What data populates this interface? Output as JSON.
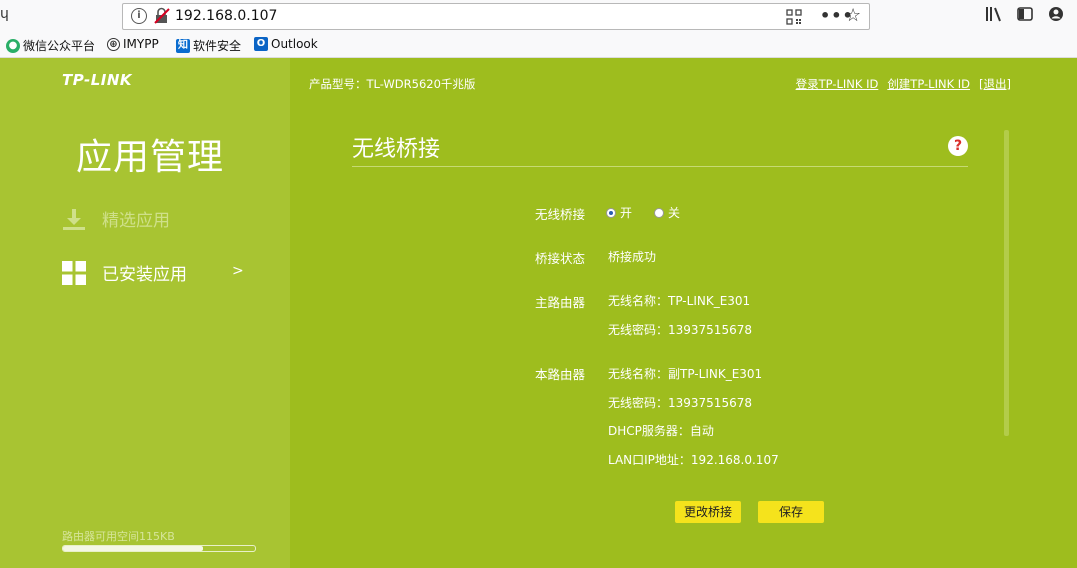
{
  "browser": {
    "url": "192.168.0.107",
    "bookmarks": [
      "微信公众平台",
      "IMYPP",
      "软件安全",
      "Outlook"
    ]
  },
  "sidebar": {
    "logo": "TP-LINK",
    "title": "应用管理",
    "items": [
      {
        "label": "精选应用"
      },
      {
        "label": "已安装应用"
      }
    ],
    "chevron": ">",
    "storage_label": "路由器可用空间115KB",
    "storage_used_fraction": 0.73
  },
  "header": {
    "model": "产品型号：TL-WDR5620千兆版",
    "login_link": "登录TP-LINK ID",
    "create_link": "创建TP-LINK ID",
    "logout_link": "[退出]"
  },
  "main": {
    "title": "无线桥接",
    "help": "?",
    "bridge_label": "无线桥接",
    "radio_on": "开",
    "radio_off": "关",
    "status_label": "桥接状态",
    "status_value": "桥接成功",
    "main_router_label": "主路由器",
    "main_ssid": "无线名称：TP-LINK_E301",
    "main_pwd": "无线密码：13937515678",
    "this_router_label": "本路由器",
    "this_ssid": "无线名称：副TP-LINK_E301",
    "this_pwd": "无线密码：13937515678",
    "dhcp": "DHCP服务器：自动",
    "lan_ip": "LAN口IP地址：192.168.0.107",
    "change_button": "更改桥接",
    "save_button": "保存"
  },
  "colors": {
    "sidebar_bg": "#a8c432",
    "main_bg": "#9ebd1e",
    "button": "#f5e31c"
  }
}
